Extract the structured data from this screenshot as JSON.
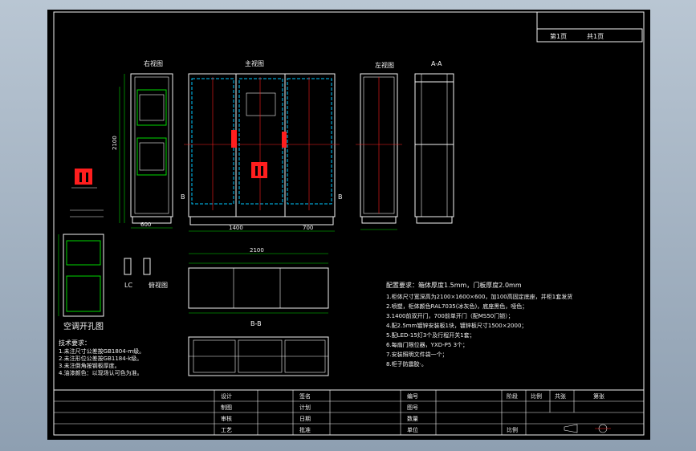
{
  "page_info": {
    "page": "第1页",
    "total": "共1页"
  },
  "views": {
    "right_view": "右视图",
    "front_view": "主视图",
    "left_view": "左视图",
    "section_aa": "A-A",
    "section_bb": "B-B",
    "top_view": "俯视图",
    "ac_cutout": "空调开孔图",
    "lc_label": "LC"
  },
  "dimensions": {
    "height": "2100",
    "width_total": "1400",
    "width_door": "700",
    "depth": "600",
    "top_total": "2100"
  },
  "config": {
    "title": "配置要求：箱体厚度1.5mm，门板厚度2.0mm",
    "items": [
      "1.柜体尺寸宽深高为2100×1600×600，加100高固定底座，并柜1套发货",
      "2.喷塑，柜体颜色RAL7035(冰灰色)，底座黑色，哑色；",
      "3.1400前双开门，700前单开门（配MS50门锁）；",
      "4.配2.5mm镀锌安装板1块，镀锌板尺寸1500×2000；",
      "5.配LED-15灯3个及行程开关1套；",
      "6.每扇门限位器，YXD-P5 3个；",
      "7.安装照明文件袋一个；",
      "8.柜子防震胶·。"
    ]
  },
  "tech_req": {
    "title": "技术要求：",
    "items": [
      "1.未注尺寸公差按GB1804-m级。",
      "2.未注形位公差按GB1184-k级。",
      "3.未注倒角按钢板厚度。",
      "4.油漆颜色：以现场认可色为准。"
    ]
  },
  "title_block": {
    "row_labels": [
      "设计",
      "制图",
      "审核",
      "工艺"
    ],
    "col2_labels": [
      "签名",
      "计划",
      "日期",
      "批准"
    ],
    "col3_labels": [
      "编号",
      "图号",
      "数量",
      "单位"
    ],
    "right_headers": [
      "阶段",
      "比例",
      "共张",
      "第张"
    ],
    "scale": "比例",
    "sheets": "第 张"
  },
  "colors": {
    "background": "#000000",
    "line": "#f2f2f2",
    "dimension": "#00d800",
    "hidden": "#00c8ff",
    "center": "#ff1e1e",
    "frame": "#ff33ff"
  }
}
